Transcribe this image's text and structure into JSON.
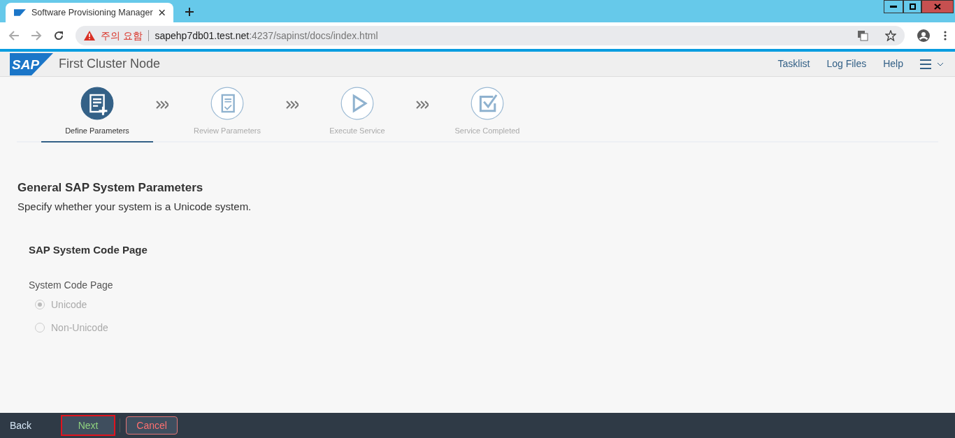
{
  "browser": {
    "tab_title": "Software Provisioning Manager",
    "security_warning": "주의 요함",
    "url_host": "sapehp7db01.test.net",
    "url_rest": ":4237/sapinst/docs/index.html"
  },
  "app": {
    "logo": "SAP",
    "title": "First Cluster Node",
    "nav": [
      "Tasklist",
      "Log Files",
      "Help"
    ]
  },
  "steps": [
    {
      "label": "Define Parameters",
      "kind": "define",
      "selected": true
    },
    {
      "label": "Review Parameters",
      "kind": "review",
      "selected": false
    },
    {
      "label": "Execute Service",
      "kind": "execute",
      "selected": false
    },
    {
      "label": "Service Completed",
      "kind": "completed",
      "selected": false
    }
  ],
  "section": {
    "title": "General SAP System Parameters",
    "description": "Specify whether your system is a Unicode system.",
    "group_title": "SAP System Code Page",
    "field_label": "System Code Page",
    "options": [
      {
        "label": "Unicode",
        "selected": true,
        "disabled": true
      },
      {
        "label": "Non-Unicode",
        "selected": false,
        "disabled": true
      }
    ]
  },
  "footer": {
    "buttons": [
      {
        "label": "Back",
        "kind": "plain",
        "highlighted": false
      },
      {
        "label": "Next",
        "kind": "accept",
        "highlighted": true
      },
      {
        "label": "Cancel",
        "kind": "reject",
        "highlighted": false
      }
    ]
  }
}
